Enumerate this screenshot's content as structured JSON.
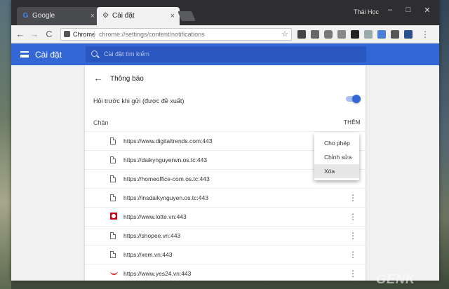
{
  "window": {
    "user": "Thái Học",
    "minimize": "–",
    "maximize": "□",
    "close": "✕"
  },
  "tabs": [
    {
      "label": "Google",
      "icon": "google-icon",
      "close": "×"
    },
    {
      "label": "Cài đặt",
      "icon": "gear-icon",
      "close": "×"
    }
  ],
  "toolbar": {
    "back": "←",
    "forward": "→",
    "reload": "C",
    "chip": "Chrome",
    "url": "chrome://settings/content/notifications",
    "star": "☆",
    "extensions": [
      "ext-icon-1",
      "ext-icon-2",
      "camera-icon",
      "ext-icon-4",
      "ext-icon-5",
      "ext-icon-6",
      "ext-icon-7",
      "puzzle-icon",
      "ext-icon-9",
      "menu-icon"
    ]
  },
  "header": {
    "title": "Cài đặt",
    "search_placeholder": "Cài đặt tìm kiếm"
  },
  "page": {
    "title": "Thông báo",
    "ask_label": "Hỏi trước khi gửi (được đề xuất)",
    "ask_enabled": true,
    "blocked_label": "Chặn",
    "add_label": "THÊM"
  },
  "sites": [
    {
      "url": "https://www.digitaltrends.com:443",
      "icon": "file-icon"
    },
    {
      "url": "https://daikynguyenvn.os.tc:443",
      "icon": "file-icon"
    },
    {
      "url": "https://homeoffice-com.os.tc:443",
      "icon": "file-icon"
    },
    {
      "url": "https://insdaikynguyen.os.tc:443",
      "icon": "file-icon"
    },
    {
      "url": "https://www.lotte.vn:443",
      "icon": "lotte-icon"
    },
    {
      "url": "https://shopee.vn:443",
      "icon": "file-icon"
    },
    {
      "url": "https://xem.vn:443",
      "icon": "file-icon"
    },
    {
      "url": "https://www.yes24.vn:443",
      "icon": "yes24-icon"
    }
  ],
  "more_glyph": "⋮",
  "menu": {
    "items": [
      "Cho phép",
      "Chỉnh sửa",
      "Xóa"
    ],
    "highlighted": "Xóa"
  },
  "watermark": "GENK"
}
